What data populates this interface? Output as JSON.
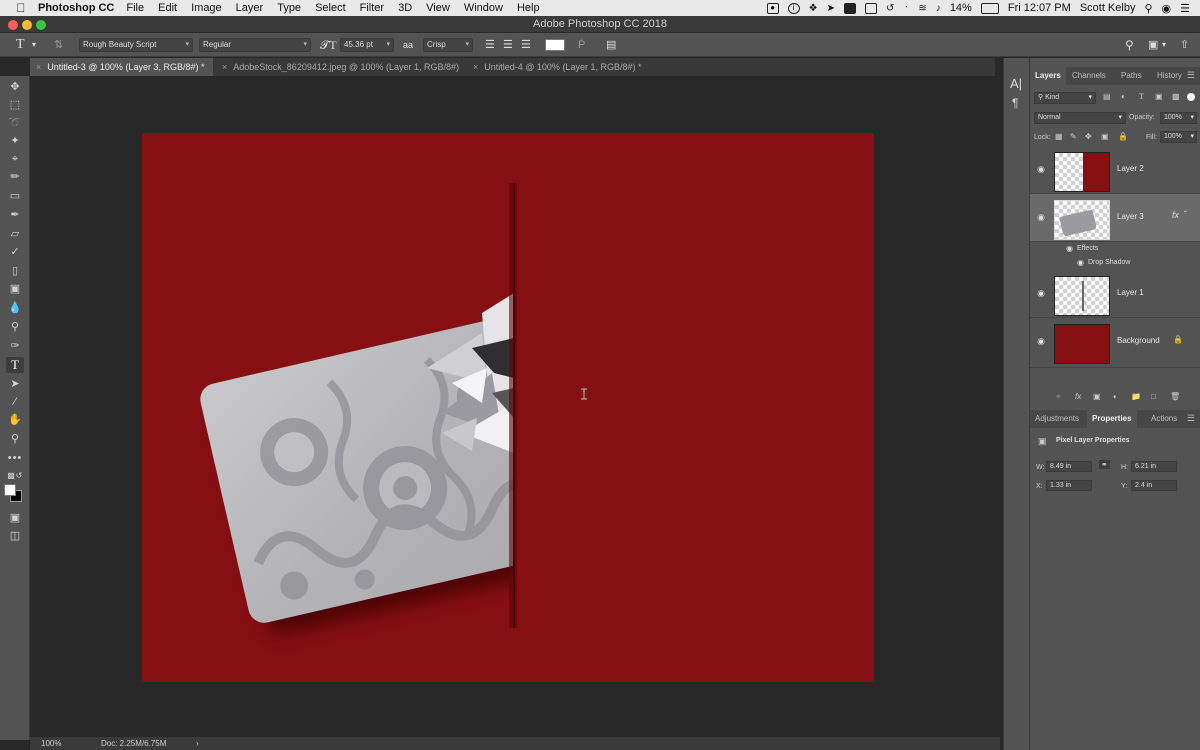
{
  "menubar": {
    "app_name": "Photoshop CC",
    "items": [
      "File",
      "Edit",
      "Image",
      "Layer",
      "Type",
      "Select",
      "Filter",
      "3D",
      "View",
      "Window",
      "Help"
    ],
    "battery": "14%",
    "clock": "Fri 12:07 PM",
    "user": "Scott Kelby"
  },
  "window": {
    "title": "Adobe Photoshop CC 2018"
  },
  "options": {
    "font_family": "Rough Beauty Script",
    "font_style": "Regular",
    "font_size": "45.36 pt",
    "antialias": "Crisp",
    "text_color": "#ffffff"
  },
  "tabs": [
    {
      "label": "Untitled-3 @ 100% (Layer 3, RGB/8#) *",
      "active": true
    },
    {
      "label": "AdobeStock_86209412.jpeg @ 100% (Layer 1, RGB/8#) *",
      "active": false
    },
    {
      "label": "Untitled-4 @ 100% (Layer 1, RGB/8#) *",
      "active": false
    }
  ],
  "status": {
    "zoom": "100%",
    "doc": "Doc: 2.25M/6.75M"
  },
  "canvas": {
    "background": "#860f13"
  },
  "layers_panel": {
    "tabs": [
      "Layers",
      "Channels",
      "Paths",
      "History"
    ],
    "filter_kind": "Kind",
    "blend_mode": "Normal",
    "opacity_label": "Opacity:",
    "opacity": "100%",
    "lock_label": "Lock:",
    "fill_label": "Fill:",
    "fill": "100%",
    "layers": [
      {
        "name": "Layer 2"
      },
      {
        "name": "Layer 3",
        "selected": true
      },
      {
        "name": "Layer 1"
      },
      {
        "name": "Background"
      }
    ],
    "effects_label": "Effects",
    "drop_shadow_label": "Drop Shadow",
    "fx_label": "fx"
  },
  "properties_panel": {
    "tabs": [
      "Adjustments",
      "Properties",
      "Actions"
    ],
    "title": "Pixel Layer Properties",
    "w_label": "W:",
    "w": "8.49 in",
    "h_label": "H:",
    "h": "6.21 in",
    "x_label": "X:",
    "x": "1.33 in",
    "y_label": "Y:",
    "y": "2.4 in"
  }
}
